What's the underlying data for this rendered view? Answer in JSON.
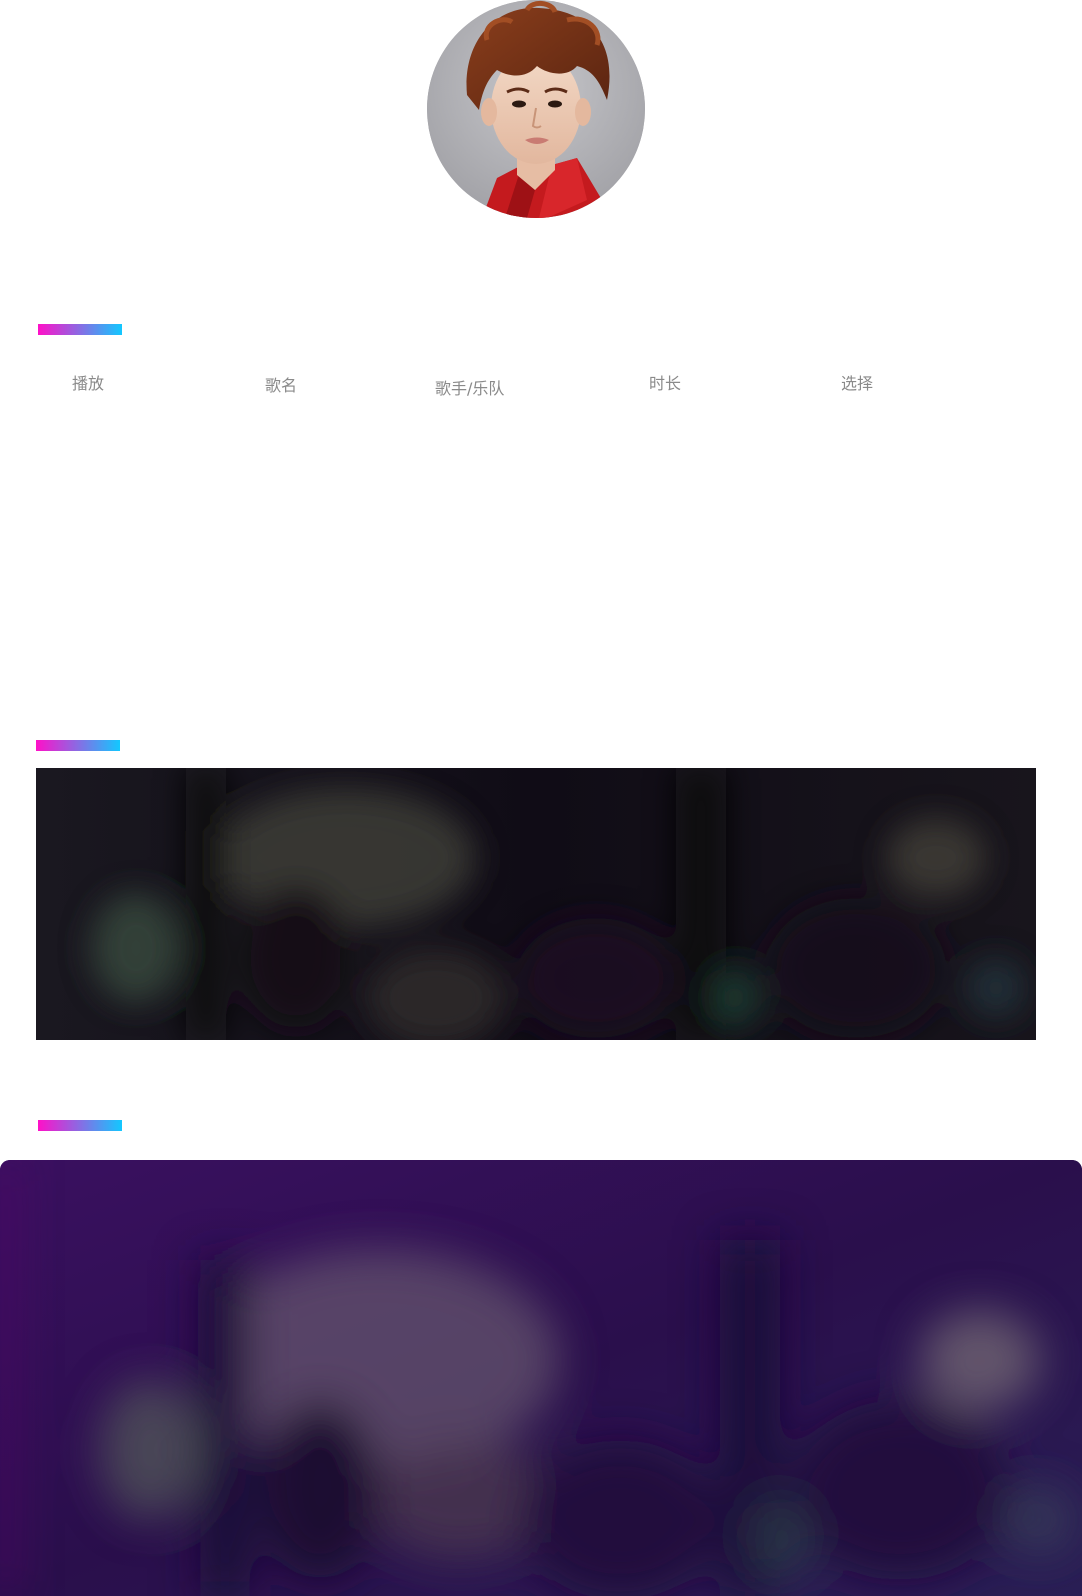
{
  "profile": {
    "avatar_alt": "artist portrait"
  },
  "sections": {
    "marker_gradient": [
      "#ff10c8",
      "#12c8ff"
    ]
  },
  "song_list": {
    "headers": {
      "play": "播放",
      "title": "歌名",
      "artist": "歌手/乐队",
      "duration": "时长",
      "select": "选择"
    },
    "rows": []
  },
  "banners": {
    "concert_banner_dark": {
      "icon": "concert-crowd-image"
    },
    "concert_banner_purple": {
      "icon": "concert-crowd-image"
    }
  },
  "colors": {
    "header_text": "#8a8a8a",
    "accent_pink": "#ff10c8",
    "accent_cyan": "#12c8ff",
    "banner_dark": "#141018",
    "banner_purple": "#2a0f4a"
  }
}
